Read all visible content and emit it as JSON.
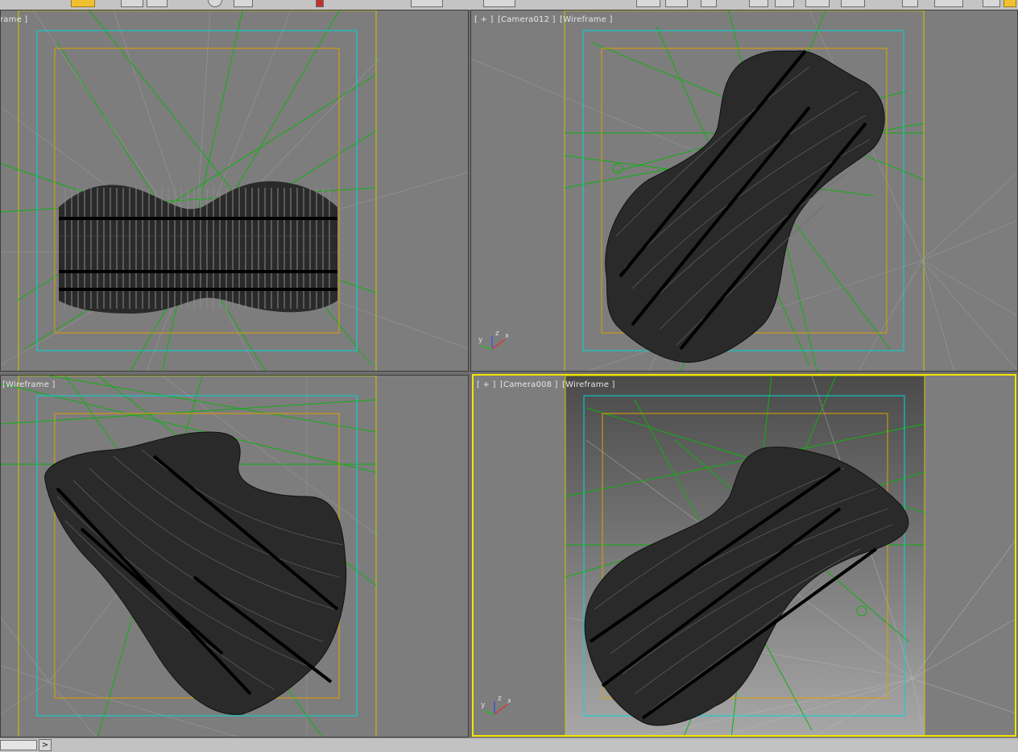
{
  "viewports": [
    {
      "id": "top-left",
      "label_parts": [
        "rame ]"
      ],
      "active": false
    },
    {
      "id": "top-right",
      "label_parts": [
        "[ + ]",
        "[Camera012 ]",
        "[Wireframe ]"
      ],
      "active": false
    },
    {
      "id": "bottom-left",
      "label_parts": [
        "[Wireframe ]"
      ],
      "active": false
    },
    {
      "id": "bottom-right",
      "label_parts": [
        "[ + ]",
        "[Camera008 ]",
        "[Wireframe ]"
      ],
      "active": true
    }
  ],
  "axis_labels": {
    "x": "x",
    "y": "y",
    "z": "z"
  },
  "statusbar": {
    "next_button": ">"
  },
  "colors": {
    "viewport_bg": "#7d7d7d",
    "active_border": "#f2e400",
    "safe_frame_outer": "#00d8d8",
    "safe_frame_inner": "#e0a000",
    "render_frame": "#c8c800",
    "light_rays": "#00c000",
    "wireframe": "#111111"
  },
  "icons": [
    "select-object-icon",
    "select-region-icon",
    "move-icon",
    "rotate-icon",
    "scale-icon",
    "snap-icon",
    "render-icon"
  ]
}
